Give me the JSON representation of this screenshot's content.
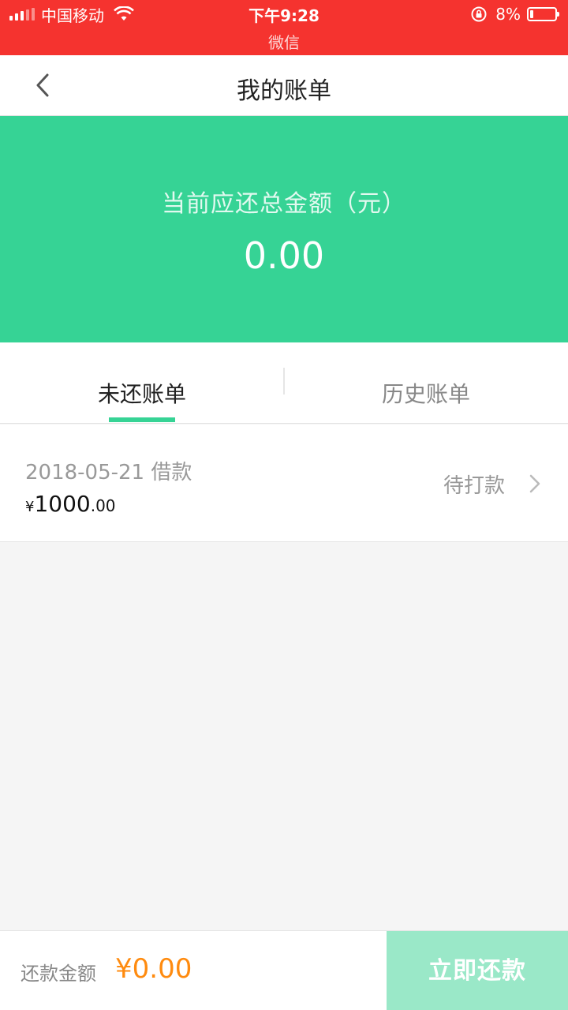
{
  "status_bar": {
    "carrier": "中国移动",
    "time": "下午9:28",
    "app": "微信",
    "battery": "8%",
    "background": "#f5332f"
  },
  "nav": {
    "title": "我的账单",
    "back_icon": "chevron-left-icon"
  },
  "summary": {
    "label": "当前应还总金额（元）",
    "amount": "0.00",
    "background": "#36d395"
  },
  "tabs": [
    {
      "label": "未还账单",
      "active": true
    },
    {
      "label": "历史账单",
      "active": false
    }
  ],
  "bills": [
    {
      "date": "2018-05-21 借款",
      "currency": "¥",
      "amount_int": "1000",
      "amount_dec": ".00",
      "status": "待打款"
    }
  ],
  "bottom": {
    "label": "还款金额",
    "amount": "¥0.00",
    "button": "立即还款",
    "amount_color": "#ff8b0f",
    "button_color": "#9ae8c8"
  }
}
